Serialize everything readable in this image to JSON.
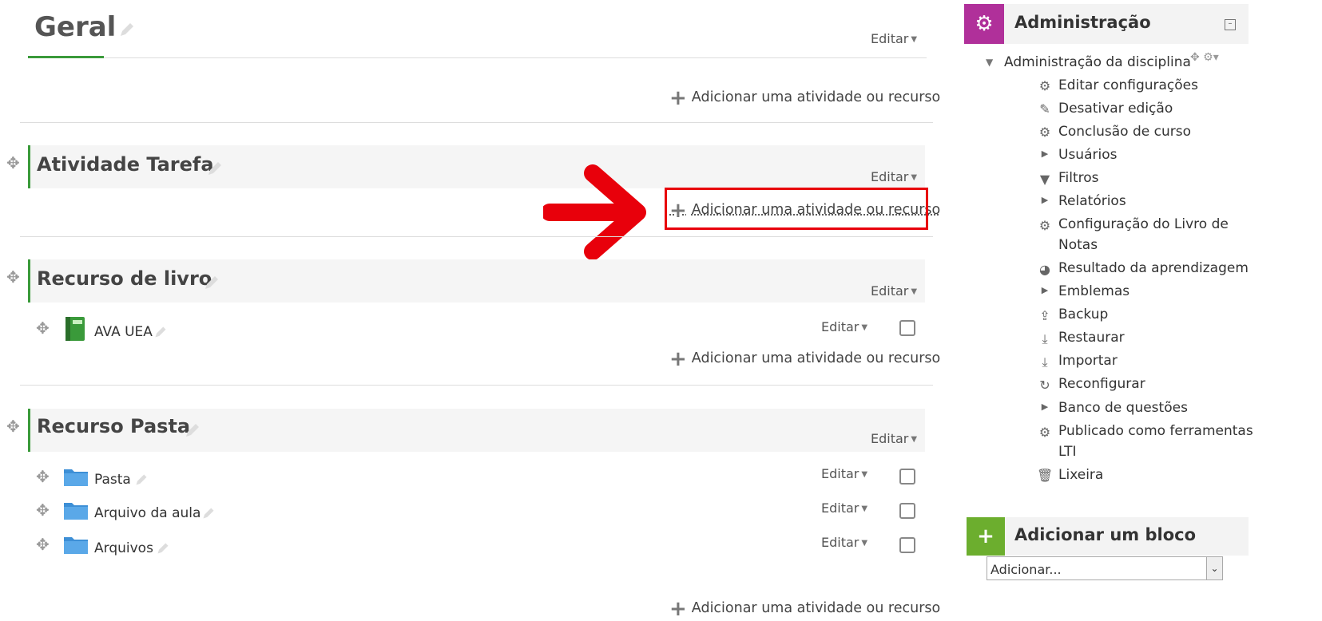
{
  "sections": {
    "geral": {
      "title": "Geral",
      "edit": "Editar",
      "add": "Adicionar uma atividade ou recurso"
    },
    "tarefa": {
      "title": "Atividade Tarefa",
      "edit": "Editar",
      "add": "Adicionar uma atividade ou recurso"
    },
    "livro": {
      "title": "Recurso de livro",
      "edit": "Editar",
      "add": "Adicionar uma atividade ou recurso",
      "activities": [
        {
          "name": "AVA UEA",
          "edit": "Editar"
        }
      ]
    },
    "pasta": {
      "title": "Recurso Pasta",
      "edit": "Editar",
      "add": "Adicionar uma atividade ou recurso",
      "activities": [
        {
          "name": "Pasta",
          "edit": "Editar"
        },
        {
          "name": "Arquivo da aula",
          "edit": "Editar"
        },
        {
          "name": "Arquivos",
          "edit": "Editar"
        }
      ]
    }
  },
  "admin": {
    "title": "Administração",
    "course_admin": "Administração da disciplina",
    "items": [
      "Editar configurações",
      "Desativar edição",
      "Conclusão de curso",
      "Usuários",
      "Filtros",
      "Relatórios",
      "Configuração do Livro de",
      "Notas",
      "Resultado da aprendizagem",
      "Emblemas",
      "Backup",
      "Restaurar",
      "Importar",
      "Reconfigurar",
      "Banco de questões",
      "Publicado como ferramentas",
      "LTI",
      "Lixeira"
    ]
  },
  "add_block": {
    "title": "Adicionar um bloco",
    "select_value": "Adicionar..."
  },
  "colors": {
    "accent": "#3a9a3a",
    "admin_icon_bg": "#b0309a",
    "block_icon_bg": "#6cae2e",
    "highlight": "#e8000b"
  }
}
